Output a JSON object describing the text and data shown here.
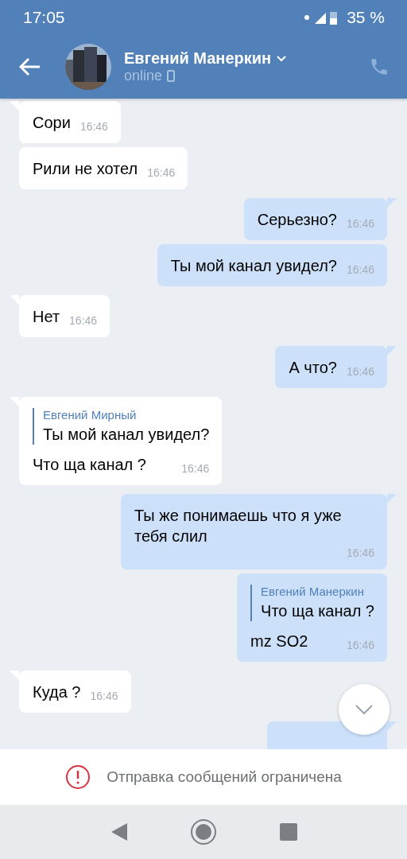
{
  "status_bar": {
    "time": "17:05",
    "battery": "35 %"
  },
  "header": {
    "name": "Евгений Манеркин",
    "status": "online"
  },
  "messages": [
    {
      "kind": "incoming",
      "tail": true,
      "text": "Сори",
      "time": "16:46"
    },
    {
      "kind": "incoming",
      "tail": false,
      "text": "Рили не хотел",
      "time": "16:46"
    },
    {
      "kind": "outgoing",
      "tail": true,
      "text": "Серьезно?",
      "time": "16:46"
    },
    {
      "kind": "outgoing",
      "tail": false,
      "text": "Ты мой канал увидел?",
      "time": "16:46"
    },
    {
      "kind": "incoming",
      "tail": true,
      "text": "Нет",
      "time": "16:46"
    },
    {
      "kind": "outgoing",
      "tail": true,
      "text": "А что?",
      "time": "16:46"
    },
    {
      "kind": "incoming",
      "tail": true,
      "reply": {
        "author": "Евгений Мирный",
        "text": "Ты мой канал увидел?"
      },
      "text": "Что ща канал ?",
      "time": "16:46"
    },
    {
      "kind": "outgoing",
      "tail": true,
      "text": "Ты же понимаешь что я уже тебя слил",
      "time": "16:46"
    },
    {
      "kind": "outgoing",
      "tail": false,
      "reply": {
        "author": "Евгений Манеркин",
        "text": "Что ща канал ?"
      },
      "text": "mz SO2",
      "time": "16:46"
    },
    {
      "kind": "incoming",
      "tail": true,
      "text": "Куда ?",
      "time": "16:46"
    },
    {
      "kind": "outgoing",
      "tail": true
    }
  ],
  "notice": "Отправка сообщений ограничена"
}
